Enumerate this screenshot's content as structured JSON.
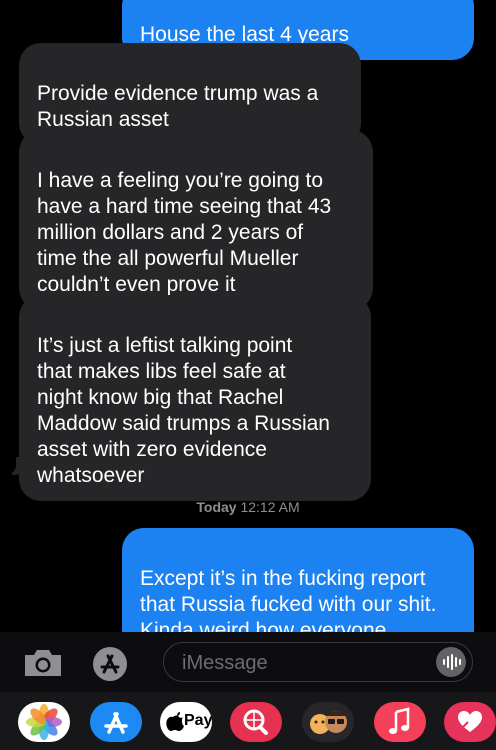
{
  "messages": [
    {
      "dir": "out",
      "text": "House the last 4 years"
    },
    {
      "dir": "in",
      "text": "Provide evidence trump was a\nRussian asset"
    },
    {
      "dir": "in",
      "text": " I have a feeling you’re going to\nhave a hard time seeing that 43\nmillion dollars and 2 years of\ntime the all powerful Mueller\ncouldn’t even prove it"
    },
    {
      "dir": "in",
      "text": "It’s just a leftist talking point\nthat makes libs feel safe at\nnight know big that Rachel\nMaddow said trumps a Russian\nasset with zero evidence\nwhatsoever"
    },
    {
      "dir": "out",
      "text": "Except it’s in the fucking report\nthat Russia fucked with our shit.\nKinda weird how everyone\nclose to trump keeps getting"
    }
  ],
  "timestamp": {
    "day": "Today",
    "time": "12:12 AM"
  },
  "composer": {
    "placeholder": "iMessage"
  },
  "icons": [
    "camera-icon",
    "app-store-icon",
    "microphone-waveform-icon"
  ],
  "app_drawer": [
    {
      "name": "photos-app-icon",
      "color": "#ffffff"
    },
    {
      "name": "app-store-app-icon",
      "color": "#1d8af4"
    },
    {
      "name": "apple-pay-app-icon",
      "label": "Pay",
      "color": "#ffffff"
    },
    {
      "name": "search-images-app-icon",
      "color": "#e53251"
    },
    {
      "name": "memoji-app-icon",
      "color": "#27272a"
    },
    {
      "name": "music-app-icon",
      "color": "#f5405a"
    },
    {
      "name": "digital-touch-app-icon",
      "color": "#e5335a"
    }
  ],
  "colors": {
    "outgoing": "#1c82f2",
    "incoming": "#262629",
    "background": "#000000"
  }
}
